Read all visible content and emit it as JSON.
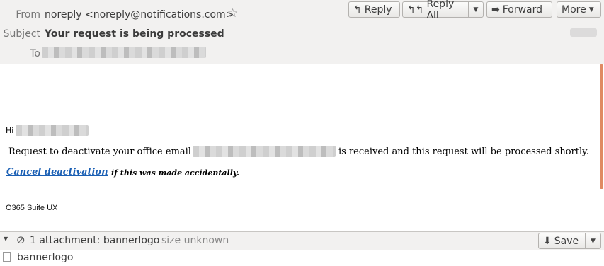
{
  "header": {
    "from_label": "From",
    "from_value": "noreply <noreply@notifications.com>",
    "subject_label": "Subject",
    "subject_value": "Your request is being processed",
    "to_label": "To",
    "buttons": {
      "reply": "Reply",
      "reply_all": "Reply All",
      "forward": "Forward",
      "more": "More"
    }
  },
  "body": {
    "greeting": "Hi",
    "line1_pre": "Request to deactivate your office email",
    "line1_post": "is received and this request will be processed shortly.",
    "cancel_link": "Cancel deactivation",
    "cancel_suffix": "if this was made accidentally.",
    "signature": "O365 Suite UX"
  },
  "attachments": {
    "summary": "1 attachment: bannerlogo",
    "size": "size unknown",
    "save_label": "Save",
    "file_name": "bannerlogo"
  },
  "colors": {
    "link": "#1a5fb4",
    "scrollbar": "#e08a63"
  }
}
